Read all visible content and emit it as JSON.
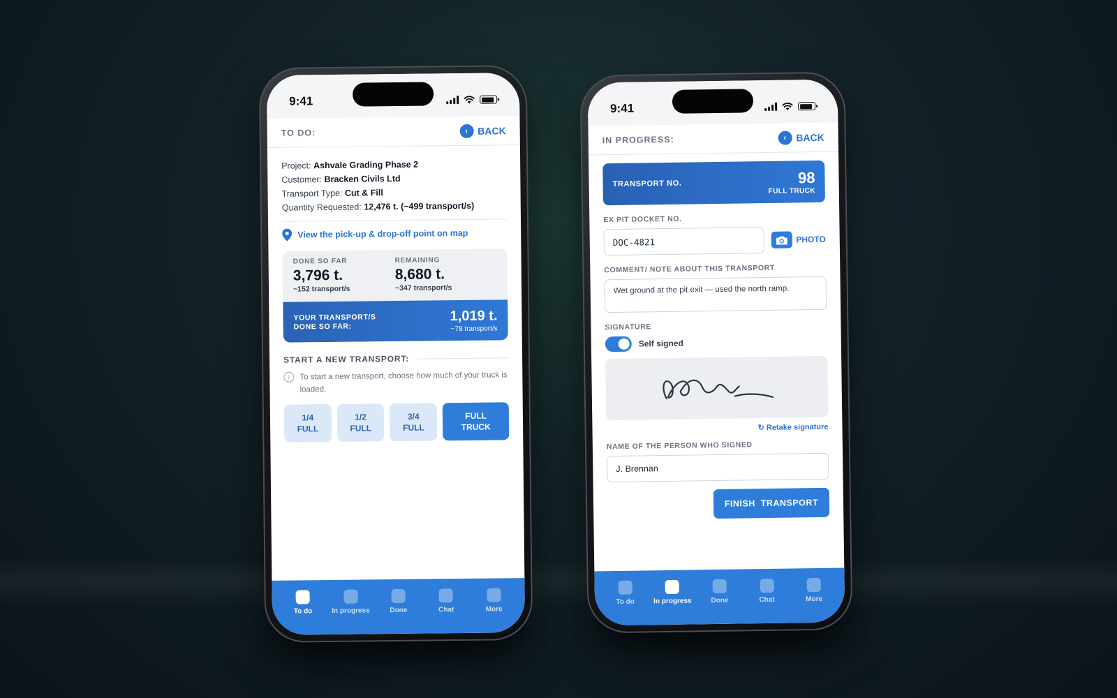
{
  "status": {
    "time": "9:41"
  },
  "todo_screen": {
    "header": {
      "title": "TO DO:",
      "back_label": "BACK"
    },
    "info": {
      "project_label": "Project:",
      "project": "Ashvale Grading Phase 2",
      "customer_label": "Customer:",
      "customer": "Bracken Civils Ltd",
      "type_label": "Transport Type:",
      "type": "Cut & Fill",
      "quantity_label": "Quantity Requested:",
      "quantity": "12,476 t. (~499 transport/s)"
    },
    "map_link": "View the pick-up & drop-off point on map",
    "stats": {
      "done_label": "DONE SO FAR",
      "done_value": "3,796 t.",
      "done_sub": "~152 transport/s",
      "remaining_label": "REMAINING",
      "remaining_value": "8,680 t.",
      "remaining_sub": "~347 transport/s",
      "yours_label_1": "YOUR TRANSPORT/S",
      "yours_label_2": "DONE SO FAR:",
      "yours_value": "1,019 t.",
      "yours_sub": "~78 transport/s"
    },
    "new_transport": {
      "title": "START A NEW TRANSPORT:",
      "hint": "To start a new transport, choose how much of your truck is loaded.",
      "options": [
        {
          "line1": "1/4",
          "line2": "FULL"
        },
        {
          "line1": "1/2",
          "line2": "FULL"
        },
        {
          "line1": "3/4",
          "line2": "FULL"
        },
        {
          "line1": "FULL",
          "line2": "TRUCK"
        }
      ]
    }
  },
  "progress_screen": {
    "header": {
      "title": "IN PROGRESS:",
      "back_label": "BACK"
    },
    "transport_card": {
      "label": "TRANSPORT NO.",
      "number": "98",
      "sub": "FULL TRUCK"
    },
    "docket": {
      "label": "EX PIT DOCKET NO.",
      "value": "DOC-4821",
      "photo_label": "PHOTO"
    },
    "comment": {
      "label": "COMMENT/ NOTE ABOUT THIS TRANSPORT",
      "value": "Wet ground at the pit exit — used the north ramp."
    },
    "signature": {
      "label": "SIGNATURE",
      "toggle_label": "Self signed",
      "self_signed": true,
      "retake_label": "↻ Retake signature"
    },
    "signer": {
      "label": "NAME OF THE PERSON WHO SIGNED",
      "value": "J. Brennan"
    },
    "finish_label": "FINISH  TRANSPORT"
  },
  "tabs": [
    {
      "label": "To do"
    },
    {
      "label": "In progress"
    },
    {
      "label": "Done"
    },
    {
      "label": "Chat"
    },
    {
      "label": "More"
    }
  ],
  "colors": {
    "accent": "#2f7ddb",
    "accent_dark": "#2b63b5",
    "background": "#13232a"
  }
}
